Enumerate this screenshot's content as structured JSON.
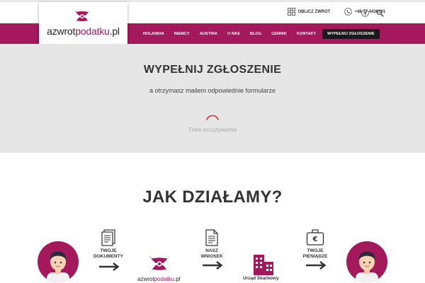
{
  "brand": {
    "logo_text_main": "azwrot",
    "logo_text_accent": "podatku",
    "logo_text_suffix": ".pl",
    "accent_color": "#a3195b"
  },
  "topbar": {
    "calc_label": "OBLICZ ZWROT",
    "phone_label": "+48 77 4436191",
    "social_icon": "facebook-icon",
    "search_icon": "search-icon"
  },
  "nav": {
    "items": [
      "HOLANDIA",
      "NIEMCY",
      "AUSTRIA",
      "O NAS",
      "BLOG",
      "CENNIK",
      "KONTAKT"
    ],
    "cta_label": "WYPEŁNIJ ZGŁOSZENIE"
  },
  "hero": {
    "title": "WYPEŁNIJ ZGŁOSZENIE",
    "subtitle": "a otrzymasz mailem odpowiednie formularze",
    "loading_text": "Trwa wczytywanie"
  },
  "how": {
    "title": "JAK DZIAŁAMY?",
    "step1_line1": "TWOJE",
    "step1_line2": "DOKUMENTY",
    "step2_line1": "NASZ",
    "step2_line2": "WNIOSEK",
    "step3_line1": "TWOJE",
    "step3_line2": "PIENIĄDZE",
    "mini_logo_main": "azwrot",
    "mini_logo_accent": "podatku",
    "mini_logo_suffix": ".pl",
    "office_label": "Urząd Skarbowy"
  }
}
